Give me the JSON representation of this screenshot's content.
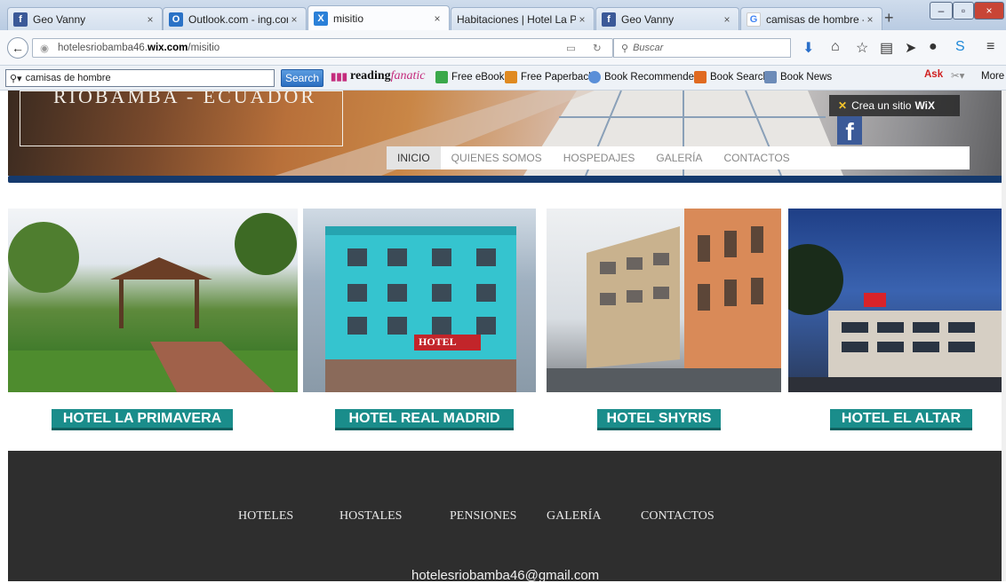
{
  "browser": {
    "tabs": [
      {
        "title": "Geo Vanny",
        "icon": "facebook-icon",
        "color": "#3b5998",
        "glyph": "f"
      },
      {
        "title": "Outlook.com - ing.com....",
        "icon": "outlook-icon",
        "color": "#2a72c6",
        "glyph": "O"
      },
      {
        "title": "misitio",
        "icon": "wix-icon",
        "color": "#2a80d8",
        "glyph": "X"
      },
      {
        "title": "Habitaciones | Hotel La Prim...",
        "icon": "none",
        "color": "",
        "glyph": ""
      },
      {
        "title": "Geo Vanny",
        "icon": "facebook-icon",
        "color": "#3b5998",
        "glyph": "f"
      },
      {
        "title": "camisas de hombre - Bu...",
        "icon": "google-icon",
        "color": "#ffffff",
        "glyph": "G"
      }
    ],
    "new_tab": "+",
    "url_prefix": "hotelesriobamba46.",
    "url_domain": "wix.com",
    "url_path": "/misitio",
    "search_placeholder": "Buscar"
  },
  "bookmarks": {
    "search_value": "camisas de hombre",
    "search_button": "Search",
    "reading_fanatic": "reading",
    "reading_fanatic_2": "fanatic",
    "items": [
      "Free eBooks",
      "Free Paperbacks",
      "Book Recommenders",
      "Book Search",
      "Book News"
    ],
    "more": "More"
  },
  "site": {
    "banner_title": "RIOBAMBA - ECUADOR",
    "wix_promo": "Crea un sitio",
    "wix_brand": "WiX",
    "menu": [
      "INICIO",
      "QUIENES SOMOS",
      "HOSPEDAJES",
      "GALERÍA",
      "CONTACTOS"
    ],
    "hotels": [
      "HOTEL LA PRIMAVERA",
      "HOTEL REAL MADRID",
      "HOTEL SHYRIS",
      "HOTEL EL ALTAR"
    ],
    "hotel_sign": "HOTEL",
    "footer_links": [
      "HOTELES",
      "HOSTALES",
      "PENSIONES",
      "GALERÍA",
      "CONTACTOS"
    ],
    "email": "hotelesriobamba46@gmail.com"
  }
}
